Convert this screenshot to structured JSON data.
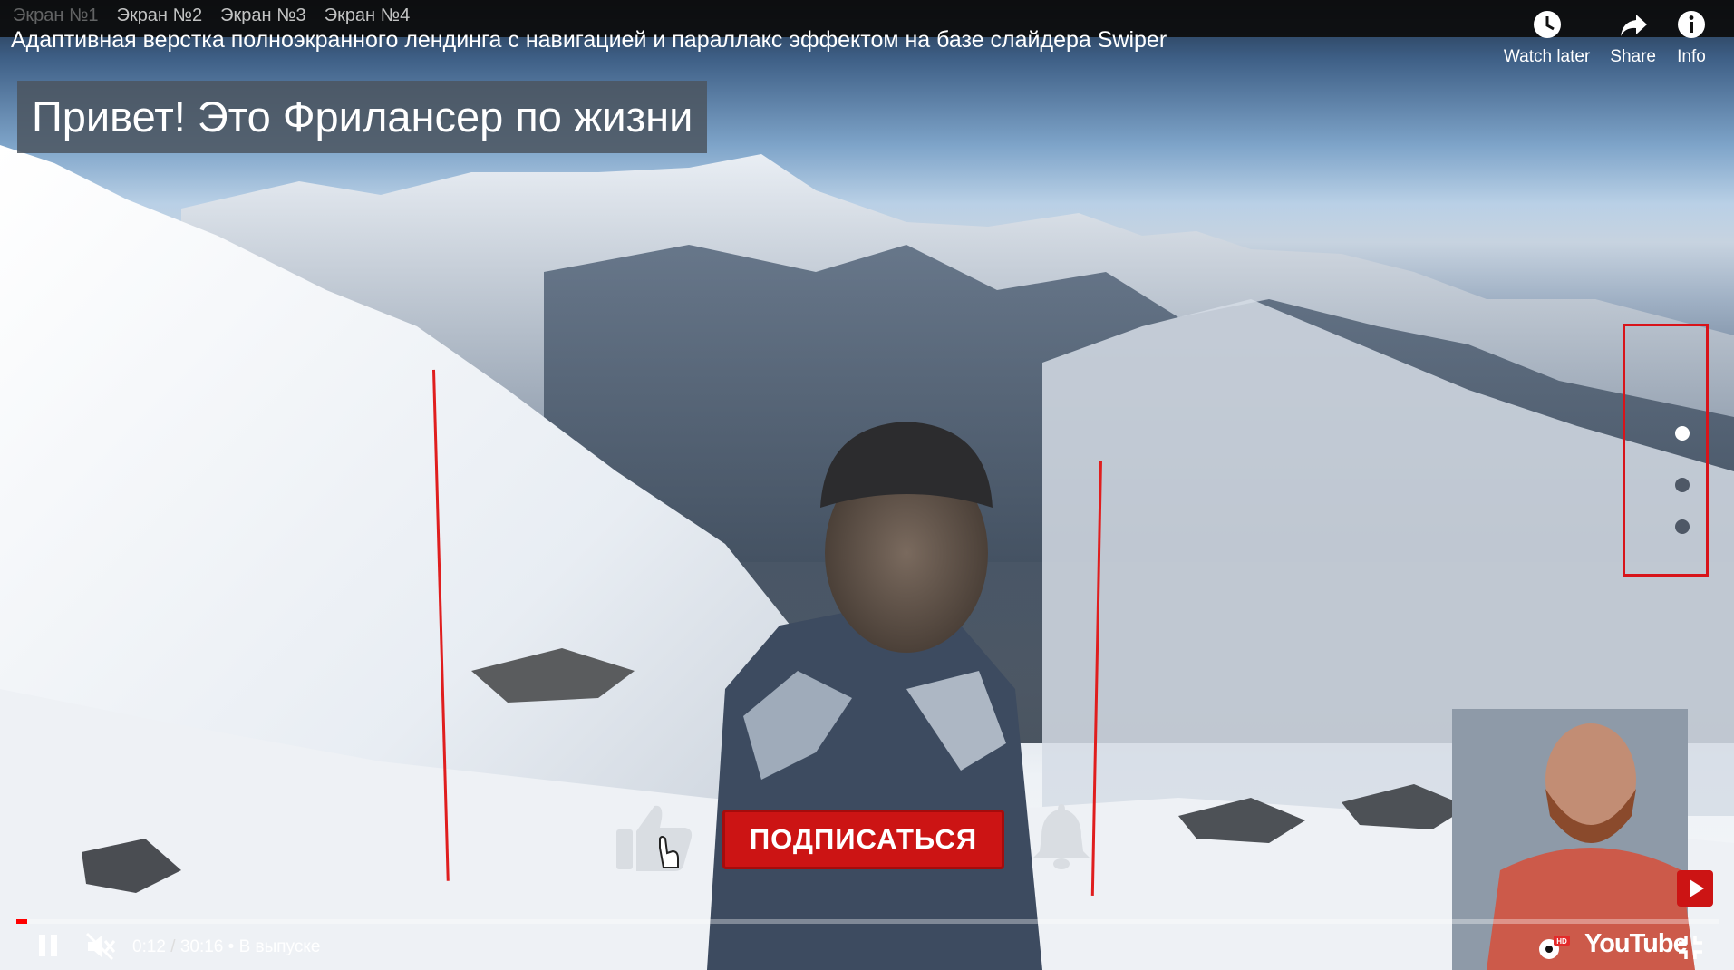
{
  "slide_nav": {
    "items": [
      "Экран №1",
      "Экран №2",
      "Экран №3",
      "Экран №4"
    ],
    "active_index": 0
  },
  "video": {
    "title": "Адаптивная верстка полноэкранного лендинга с навигацией и параллакс эффектом на базе слайдера Swiper",
    "headline": "Привет! Это Фрилансер по жизни"
  },
  "top_actions": {
    "watch_later": "Watch later",
    "share": "Share",
    "info": "Info"
  },
  "subscribe": {
    "label": "ПОДПИСАТЬСЯ"
  },
  "player": {
    "current_time": "0:12",
    "duration": "30:16",
    "separator": " / ",
    "chapter": "• В выпуске",
    "progress_fraction": 0.0066,
    "logo": "YouTube",
    "badge": "HD"
  },
  "colors": {
    "accent_red": "#cc1414",
    "annotation_red": "#d8141a",
    "progress_red": "#ff0000"
  }
}
